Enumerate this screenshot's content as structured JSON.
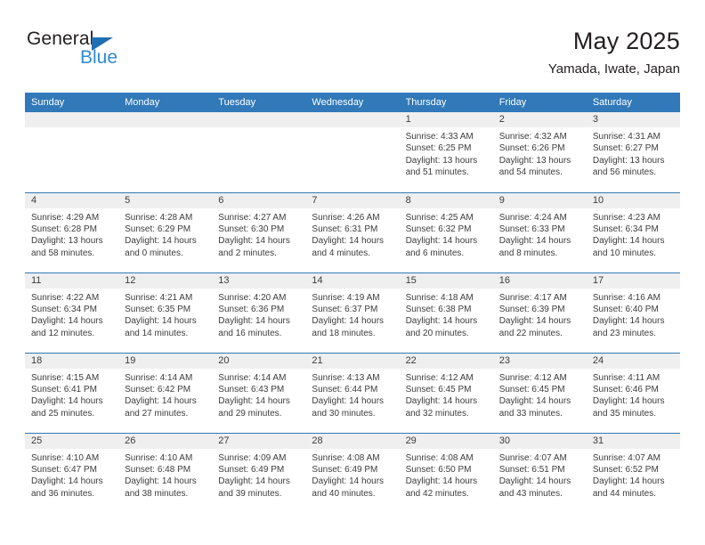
{
  "brand": {
    "name_top": "General",
    "name_bottom": "Blue",
    "triangle_color": "#1f6fb2",
    "top_color": "#231f20",
    "bottom_color": "#2e8bd6"
  },
  "header": {
    "title": "May 2025",
    "subtitle": "Yamada, Iwate, Japan"
  },
  "colors": {
    "header_band": "#3179b8",
    "daynum_band": "#efefef",
    "text": "#3c3c3c",
    "row_rule": "#3179b8"
  },
  "weekday_headers": [
    "Sunday",
    "Monday",
    "Tuesday",
    "Wednesday",
    "Thursday",
    "Friday",
    "Saturday"
  ],
  "weeks": [
    [
      {
        "day": "",
        "empty": true
      },
      {
        "day": "",
        "empty": true
      },
      {
        "day": "",
        "empty": true
      },
      {
        "day": "",
        "empty": true
      },
      {
        "day": "1",
        "sunrise": "Sunrise: 4:33 AM",
        "sunset": "Sunset: 6:25 PM",
        "daylight_1": "Daylight: 13 hours",
        "daylight_2": "and 51 minutes."
      },
      {
        "day": "2",
        "sunrise": "Sunrise: 4:32 AM",
        "sunset": "Sunset: 6:26 PM",
        "daylight_1": "Daylight: 13 hours",
        "daylight_2": "and 54 minutes."
      },
      {
        "day": "3",
        "sunrise": "Sunrise: 4:31 AM",
        "sunset": "Sunset: 6:27 PM",
        "daylight_1": "Daylight: 13 hours",
        "daylight_2": "and 56 minutes."
      }
    ],
    [
      {
        "day": "4",
        "sunrise": "Sunrise: 4:29 AM",
        "sunset": "Sunset: 6:28 PM",
        "daylight_1": "Daylight: 13 hours",
        "daylight_2": "and 58 minutes."
      },
      {
        "day": "5",
        "sunrise": "Sunrise: 4:28 AM",
        "sunset": "Sunset: 6:29 PM",
        "daylight_1": "Daylight: 14 hours",
        "daylight_2": "and 0 minutes."
      },
      {
        "day": "6",
        "sunrise": "Sunrise: 4:27 AM",
        "sunset": "Sunset: 6:30 PM",
        "daylight_1": "Daylight: 14 hours",
        "daylight_2": "and 2 minutes."
      },
      {
        "day": "7",
        "sunrise": "Sunrise: 4:26 AM",
        "sunset": "Sunset: 6:31 PM",
        "daylight_1": "Daylight: 14 hours",
        "daylight_2": "and 4 minutes."
      },
      {
        "day": "8",
        "sunrise": "Sunrise: 4:25 AM",
        "sunset": "Sunset: 6:32 PM",
        "daylight_1": "Daylight: 14 hours",
        "daylight_2": "and 6 minutes."
      },
      {
        "day": "9",
        "sunrise": "Sunrise: 4:24 AM",
        "sunset": "Sunset: 6:33 PM",
        "daylight_1": "Daylight: 14 hours",
        "daylight_2": "and 8 minutes."
      },
      {
        "day": "10",
        "sunrise": "Sunrise: 4:23 AM",
        "sunset": "Sunset: 6:34 PM",
        "daylight_1": "Daylight: 14 hours",
        "daylight_2": "and 10 minutes."
      }
    ],
    [
      {
        "day": "11",
        "sunrise": "Sunrise: 4:22 AM",
        "sunset": "Sunset: 6:34 PM",
        "daylight_1": "Daylight: 14 hours",
        "daylight_2": "and 12 minutes."
      },
      {
        "day": "12",
        "sunrise": "Sunrise: 4:21 AM",
        "sunset": "Sunset: 6:35 PM",
        "daylight_1": "Daylight: 14 hours",
        "daylight_2": "and 14 minutes."
      },
      {
        "day": "13",
        "sunrise": "Sunrise: 4:20 AM",
        "sunset": "Sunset: 6:36 PM",
        "daylight_1": "Daylight: 14 hours",
        "daylight_2": "and 16 minutes."
      },
      {
        "day": "14",
        "sunrise": "Sunrise: 4:19 AM",
        "sunset": "Sunset: 6:37 PM",
        "daylight_1": "Daylight: 14 hours",
        "daylight_2": "and 18 minutes."
      },
      {
        "day": "15",
        "sunrise": "Sunrise: 4:18 AM",
        "sunset": "Sunset: 6:38 PM",
        "daylight_1": "Daylight: 14 hours",
        "daylight_2": "and 20 minutes."
      },
      {
        "day": "16",
        "sunrise": "Sunrise: 4:17 AM",
        "sunset": "Sunset: 6:39 PM",
        "daylight_1": "Daylight: 14 hours",
        "daylight_2": "and 22 minutes."
      },
      {
        "day": "17",
        "sunrise": "Sunrise: 4:16 AM",
        "sunset": "Sunset: 6:40 PM",
        "daylight_1": "Daylight: 14 hours",
        "daylight_2": "and 23 minutes."
      }
    ],
    [
      {
        "day": "18",
        "sunrise": "Sunrise: 4:15 AM",
        "sunset": "Sunset: 6:41 PM",
        "daylight_1": "Daylight: 14 hours",
        "daylight_2": "and 25 minutes."
      },
      {
        "day": "19",
        "sunrise": "Sunrise: 4:14 AM",
        "sunset": "Sunset: 6:42 PM",
        "daylight_1": "Daylight: 14 hours",
        "daylight_2": "and 27 minutes."
      },
      {
        "day": "20",
        "sunrise": "Sunrise: 4:14 AM",
        "sunset": "Sunset: 6:43 PM",
        "daylight_1": "Daylight: 14 hours",
        "daylight_2": "and 29 minutes."
      },
      {
        "day": "21",
        "sunrise": "Sunrise: 4:13 AM",
        "sunset": "Sunset: 6:44 PM",
        "daylight_1": "Daylight: 14 hours",
        "daylight_2": "and 30 minutes."
      },
      {
        "day": "22",
        "sunrise": "Sunrise: 4:12 AM",
        "sunset": "Sunset: 6:45 PM",
        "daylight_1": "Daylight: 14 hours",
        "daylight_2": "and 32 minutes."
      },
      {
        "day": "23",
        "sunrise": "Sunrise: 4:12 AM",
        "sunset": "Sunset: 6:45 PM",
        "daylight_1": "Daylight: 14 hours",
        "daylight_2": "and 33 minutes."
      },
      {
        "day": "24",
        "sunrise": "Sunrise: 4:11 AM",
        "sunset": "Sunset: 6:46 PM",
        "daylight_1": "Daylight: 14 hours",
        "daylight_2": "and 35 minutes."
      }
    ],
    [
      {
        "day": "25",
        "sunrise": "Sunrise: 4:10 AM",
        "sunset": "Sunset: 6:47 PM",
        "daylight_1": "Daylight: 14 hours",
        "daylight_2": "and 36 minutes."
      },
      {
        "day": "26",
        "sunrise": "Sunrise: 4:10 AM",
        "sunset": "Sunset: 6:48 PM",
        "daylight_1": "Daylight: 14 hours",
        "daylight_2": "and 38 minutes."
      },
      {
        "day": "27",
        "sunrise": "Sunrise: 4:09 AM",
        "sunset": "Sunset: 6:49 PM",
        "daylight_1": "Daylight: 14 hours",
        "daylight_2": "and 39 minutes."
      },
      {
        "day": "28",
        "sunrise": "Sunrise: 4:08 AM",
        "sunset": "Sunset: 6:49 PM",
        "daylight_1": "Daylight: 14 hours",
        "daylight_2": "and 40 minutes."
      },
      {
        "day": "29",
        "sunrise": "Sunrise: 4:08 AM",
        "sunset": "Sunset: 6:50 PM",
        "daylight_1": "Daylight: 14 hours",
        "daylight_2": "and 42 minutes."
      },
      {
        "day": "30",
        "sunrise": "Sunrise: 4:07 AM",
        "sunset": "Sunset: 6:51 PM",
        "daylight_1": "Daylight: 14 hours",
        "daylight_2": "and 43 minutes."
      },
      {
        "day": "31",
        "sunrise": "Sunrise: 4:07 AM",
        "sunset": "Sunset: 6:52 PM",
        "daylight_1": "Daylight: 14 hours",
        "daylight_2": "and 44 minutes."
      }
    ]
  ]
}
